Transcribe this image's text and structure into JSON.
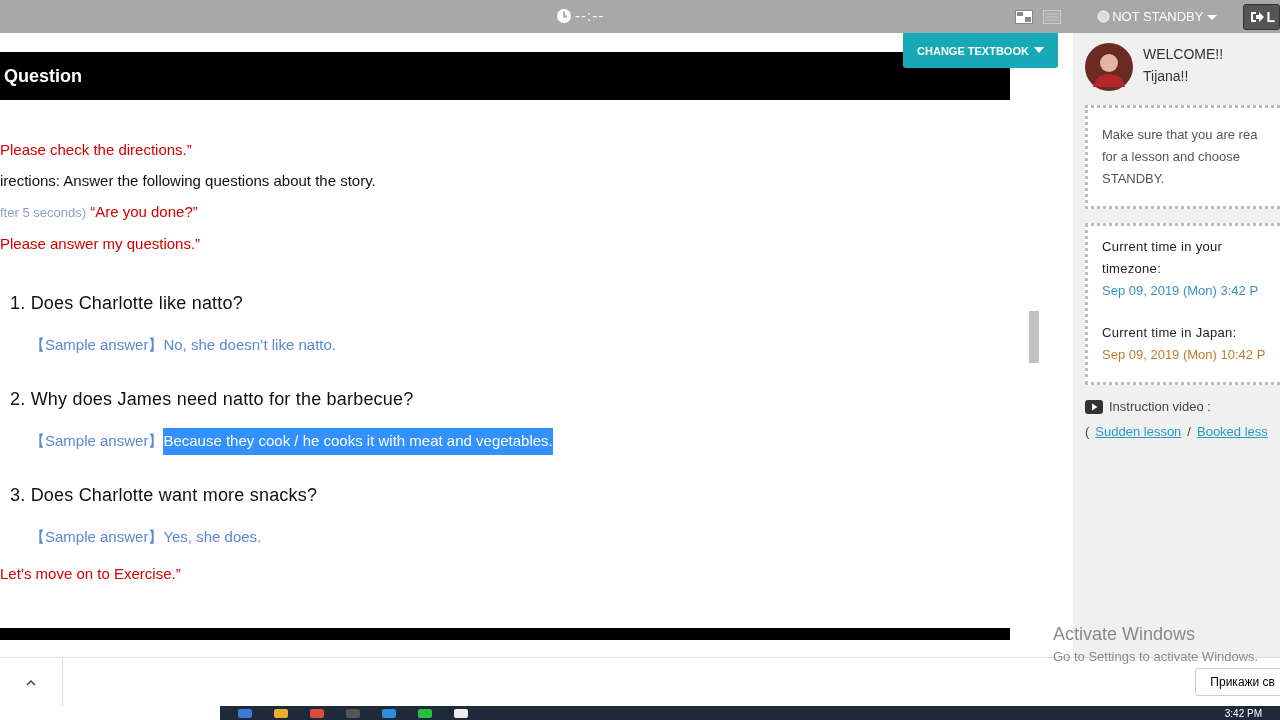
{
  "top_bar": {
    "timer": "--:--",
    "status": "NOT STANDBY",
    "logout_label": "L"
  },
  "change_textbook": "CHANGE TEXTBOOK",
  "section_title": "Question",
  "lines": [
    {
      "kind": "instruction",
      "text": "Please check the directions.”"
    },
    {
      "kind": "directions",
      "text": "irections: Answer the following questions about the story."
    },
    {
      "kind": "cue",
      "note": "fter 5 seconds)",
      "text": "“Are you done?”"
    },
    {
      "kind": "instruction",
      "text": "Please answer my questions.”"
    }
  ],
  "questions": [
    {
      "number": "1.",
      "text": "Does Charlotte like natto?",
      "answer_label": "【Sample answer】",
      "answer": "No, she doesn’t like natto.",
      "highlighted": false
    },
    {
      "number": "2.",
      "text": "Why does James need natto for the barbecue?",
      "answer_label": "【Sample answer】",
      "answer": "Because they cook / he cooks it with meat and vegetables.",
      "highlighted": true
    },
    {
      "number": "3.",
      "text": "Does Charlotte want more snacks?",
      "answer_label": "【Sample answer】",
      "answer": "Yes, she does.",
      "highlighted": false
    }
  ],
  "closing": "Let’s move on to Exercise.”",
  "sidebar": {
    "welcome": "WELCOME!!",
    "name": "Tijana!!",
    "notice": [
      "Make sure that you are rea",
      "for a lesson and choose",
      "STANDBY."
    ],
    "local_label": "Current time in your timezone:",
    "local_time": "Sep 09, 2019 (Mon) 3:42 P",
    "japan_label": "Current time in Japan:",
    "japan_time": "Sep 09, 2019 (Mon) 10:42 P",
    "video_label": "Instruction video :",
    "links_open": "(",
    "links": [
      "Sudden lesson",
      "Booked less"
    ],
    "links_sep": "/"
  },
  "downloads_bar": {
    "button": "Прикажи св"
  },
  "os_notice": {
    "title": "Activate Windows",
    "text": "Go to Settings to activate Windows."
  },
  "taskbar": {
    "clock": "3:42 PM"
  }
}
